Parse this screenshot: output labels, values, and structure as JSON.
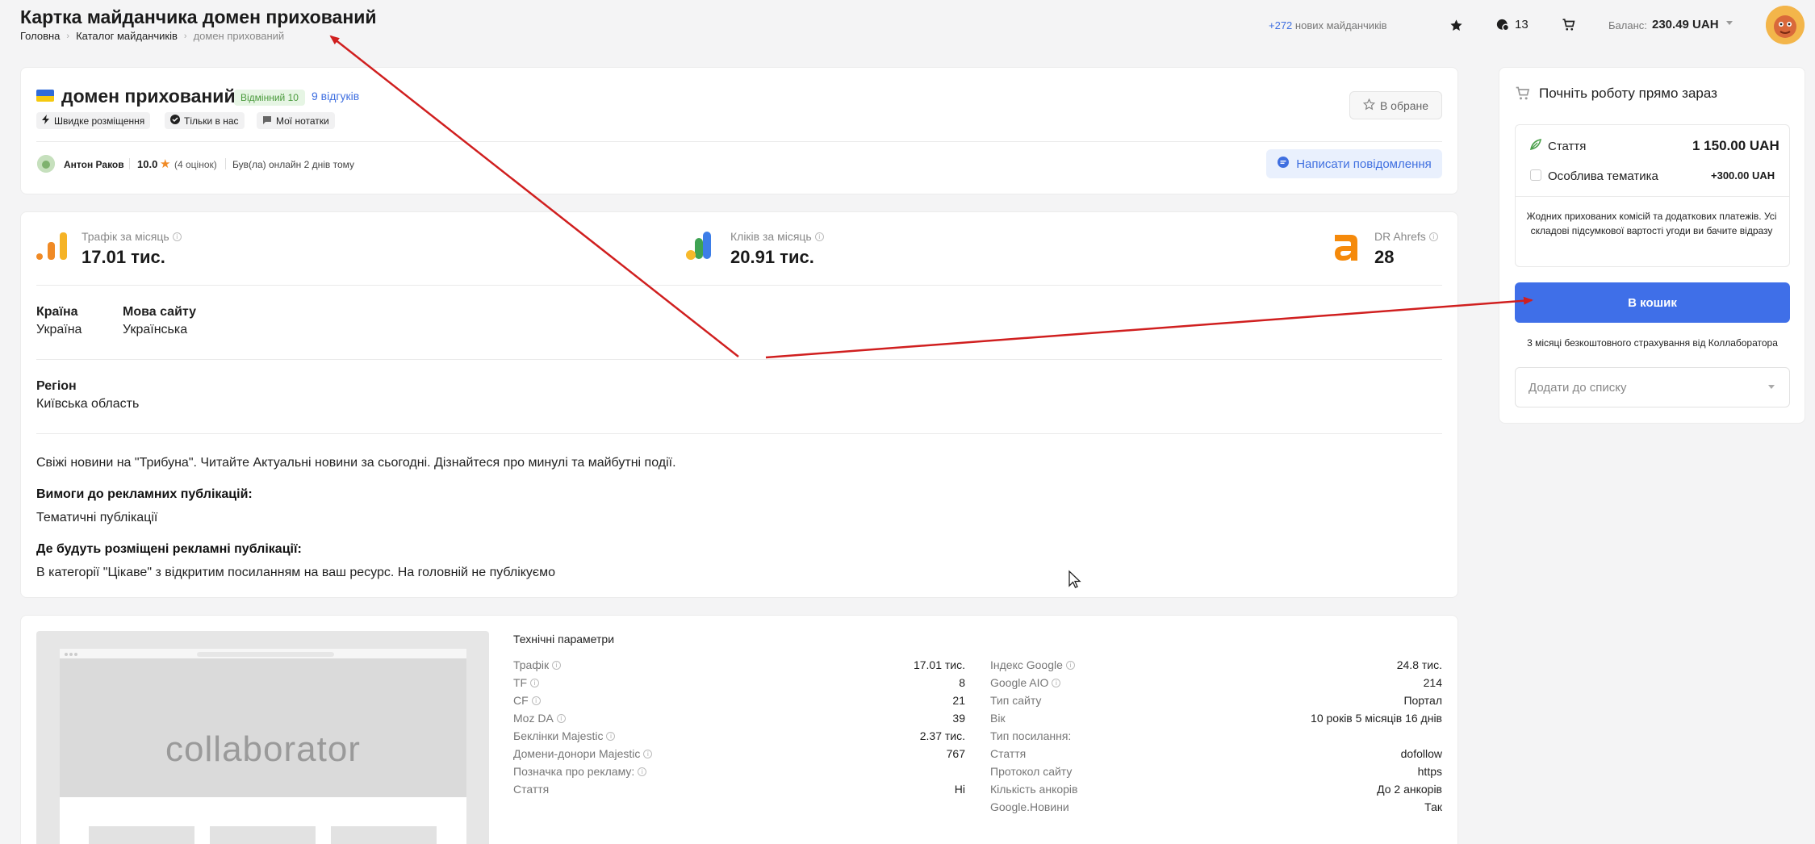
{
  "page": {
    "title": "Картка майданчика домен прихований",
    "breadcrumb": [
      "Головна",
      "Каталог майданчиків",
      "домен прихований"
    ]
  },
  "topbar": {
    "new_sites_count": "+272",
    "new_sites_text": "нових майданчиків",
    "messages_count": "13",
    "balance_label": "Баланс:",
    "balance_value": "230.49 UAH"
  },
  "site": {
    "name": "домен прихований",
    "rating_badge": "Відмінний 10",
    "reviews_link": "9 відгуків",
    "tags": [
      "Швидке розміщення",
      "Тільки в нас",
      "Мої нотатки"
    ],
    "favorite_label": "В обране",
    "seller_name": "Антон Раков",
    "seller_score": "10.0",
    "seller_reviews": "(4 оцінок)",
    "seller_online": "Був(ла) онлайн 2 днів тому",
    "message_button": "Написати повідомлення"
  },
  "stats": {
    "traffic_label": "Трафік за місяць",
    "traffic_value": "17.01 тис.",
    "clicks_label": "Кліків за місяць",
    "clicks_value": "20.91 тис.",
    "dr_label": "DR Ahrefs",
    "dr_value": "28",
    "country_label": "Країна",
    "country_value": "Україна",
    "language_label": "Мова сайту",
    "language_value": "Українська",
    "region_label": "Регіон",
    "region_value": "Київська область",
    "description": "Свіжі новини на \"Трибуна\". Читайте Актуальні новини за сьогодні. Дізнайтеся про минулі та майбутні події.",
    "requirements_label": "Вимоги до рекламних публікацій:",
    "requirements_value": "Тематичні публікації",
    "placement_label": "Де будуть розміщені рекламні публікації:",
    "placement_value": "В категорії \"Цікаве\" з відкритим посиланням на ваш ресурс. На головній не публікуємо"
  },
  "tech": {
    "preview_logo": "collaborator",
    "title": "Технічні параметри",
    "left": [
      {
        "k": "Трафік",
        "v": "17.01 тис."
      },
      {
        "k": "TF",
        "v": "8"
      },
      {
        "k": "CF",
        "v": "21"
      },
      {
        "k": "Moz DA",
        "v": "39"
      },
      {
        "k": "Беклінки Majestic",
        "v": "2.37 тис."
      },
      {
        "k": "Домени-донори Majestic",
        "v": "767"
      },
      {
        "k": "Позначка про рекламу:",
        "v": ""
      },
      {
        "k": "Стаття",
        "v": "Ні"
      }
    ],
    "right": [
      {
        "k": "Індекс Google",
        "v": "24.8 тис."
      },
      {
        "k": "Google AIO",
        "v": "214"
      },
      {
        "k": "Тип сайту",
        "v": "Портал"
      },
      {
        "k": "Вік",
        "v": "10 років 5 місяців 16 днів"
      },
      {
        "k": "Тип посилання:",
        "v": ""
      },
      {
        "k": "Стаття",
        "v": "dofollow"
      },
      {
        "k": "Протокол сайту",
        "v": "https"
      },
      {
        "k": "Кількість анкорів",
        "v": "До 2 анкорів"
      },
      {
        "k": "Google.Новини",
        "v": "Так"
      }
    ]
  },
  "cart": {
    "title": "Почніть роботу прямо зараз",
    "article_label": "Стаття",
    "article_price": "1 150.00 UAH",
    "special_label": "Особлива тематика",
    "special_price": "+300.00 UAH",
    "note": "Жодних прихованих комісій та додаткових платежів. Усі складові підсумкової вартості угоди ви бачите відразу",
    "button": "В кошик",
    "insurance": "3 місяці безкоштовного страхування від Коллаборатора",
    "list_placeholder": "Додати до списку"
  },
  "colors": {
    "accent": "#3f6fe8",
    "annotation_arrow": "#d01f1f",
    "ahrefs_orange": "#f58a0b"
  }
}
